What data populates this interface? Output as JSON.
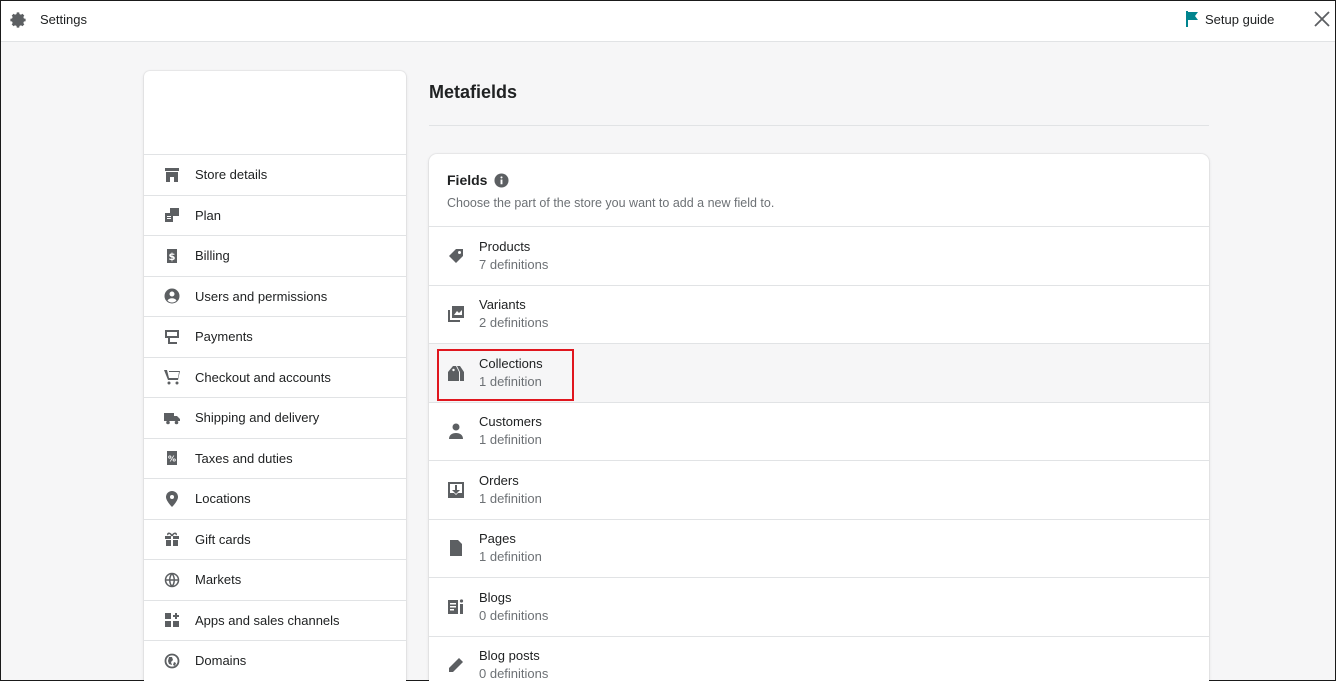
{
  "topbar": {
    "title": "Settings",
    "setup_guide": "Setup guide",
    "gear_icon": "gear-icon",
    "flag_color": "#00848e"
  },
  "sidebar": {
    "items": [
      {
        "label": "Store details",
        "icon": "store-icon"
      },
      {
        "label": "Plan",
        "icon": "plan-icon"
      },
      {
        "label": "Billing",
        "icon": "billing-icon"
      },
      {
        "label": "Users and permissions",
        "icon": "user-circle-icon"
      },
      {
        "label": "Payments",
        "icon": "payments-icon"
      },
      {
        "label": "Checkout and accounts",
        "icon": "cart-icon"
      },
      {
        "label": "Shipping and delivery",
        "icon": "truck-icon"
      },
      {
        "label": "Taxes and duties",
        "icon": "tax-icon"
      },
      {
        "label": "Locations",
        "icon": "location-icon"
      },
      {
        "label": "Gift cards",
        "icon": "gift-icon"
      },
      {
        "label": "Markets",
        "icon": "globe-icon"
      },
      {
        "label": "Apps and sales channels",
        "icon": "apps-icon"
      },
      {
        "label": "Domains",
        "icon": "domains-icon"
      }
    ]
  },
  "main": {
    "title": "Metafields",
    "card": {
      "heading": "Fields",
      "subtitle": "Choose the part of the store you want to add a new field to.",
      "rows": [
        {
          "title": "Products",
          "count": "7 definitions",
          "icon": "tag-icon"
        },
        {
          "title": "Variants",
          "count": "2 definitions",
          "icon": "variants-icon"
        },
        {
          "title": "Collections",
          "count": "1 definition",
          "icon": "collections-icon"
        },
        {
          "title": "Customers",
          "count": "1 definition",
          "icon": "customer-icon"
        },
        {
          "title": "Orders",
          "count": "1 definition",
          "icon": "orders-icon"
        },
        {
          "title": "Pages",
          "count": "1 definition",
          "icon": "page-icon"
        },
        {
          "title": "Blogs",
          "count": "0 definitions",
          "icon": "blog-icon"
        },
        {
          "title": "Blog posts",
          "count": "0 definitions",
          "icon": "pencil-icon"
        }
      ]
    }
  },
  "highlight_color": "#e0161e"
}
